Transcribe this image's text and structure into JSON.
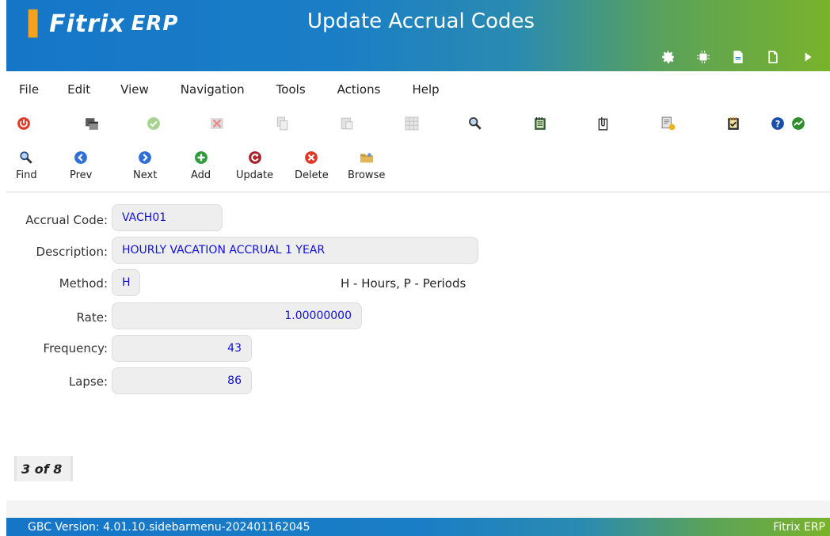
{
  "header": {
    "logo_text": "Fitrix",
    "logo_suffix": "ERP",
    "title": "Update Accrual Codes",
    "icons": [
      "gear-icon",
      "chip-icon",
      "document-icon",
      "file-icon",
      "play-icon"
    ]
  },
  "menu": [
    "File",
    "Edit",
    "View",
    "Navigation",
    "Tools",
    "Actions",
    "Help"
  ],
  "toolbar_icons": [
    "power-icon",
    "window-icon",
    "check-icon",
    "cancel-icon",
    "copy-icon",
    "paste-icon",
    "grid-icon",
    "zoom-icon",
    "notebook-icon",
    "clip-icon",
    "report-icon",
    "checklist-icon",
    "chart-icon",
    "help-icon"
  ],
  "actions": {
    "find": "Find",
    "prev": "Prev",
    "next": "Next",
    "add": "Add",
    "update": "Update",
    "delete": "Delete",
    "browse": "Browse"
  },
  "form": {
    "accrual_code": {
      "label": "Accrual Code:",
      "value": "VACH01"
    },
    "description": {
      "label": "Description:",
      "value": "HOURLY VACATION ACCRUAL 1 YEAR"
    },
    "method": {
      "label": "Method:",
      "value": "H",
      "hint": "H - Hours, P - Periods"
    },
    "rate": {
      "label": "Rate:",
      "value": "1.00000000"
    },
    "frequency": {
      "label": "Frequency:",
      "value": "43"
    },
    "lapse": {
      "label": "Lapse:",
      "value": "86"
    }
  },
  "record_position": "3 of 8",
  "status": {
    "version": "GBC Version: 4.01.10.sidebarmenu-202401162045",
    "app_name": "Fitrix ERP"
  },
  "colors": {
    "header_blue": "#1576c8",
    "header_green": "#79b32a",
    "field_text": "#1010d8",
    "logo_accent": "#f7a21b"
  }
}
